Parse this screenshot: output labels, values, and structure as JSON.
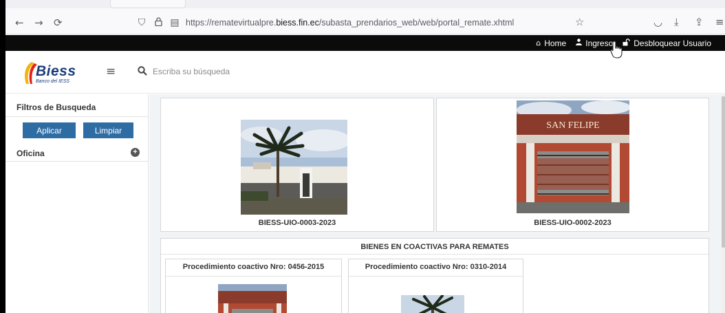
{
  "browser": {
    "url_prefix": "https://rematevirtualpre.",
    "url_domain": "biess.fin.ec",
    "url_path": "/subasta_prendarios_web/web/portal_remate.xhtml",
    "icons": {
      "back": "←",
      "forward": "→",
      "reload": "⟳",
      "shield": "⛉",
      "lock": "🔒",
      "reader": "▤",
      "star": "☆",
      "pocket": "◡",
      "download": "⤓",
      "share": "⇪",
      "menu": "≡"
    }
  },
  "topnav": {
    "home": "Home",
    "home_icon": "⌂",
    "login": "Ingreso",
    "login_icon": "👤",
    "unlock": "Desbloquear Usuario",
    "unlock_icon": "🔓"
  },
  "header": {
    "logo_text": "Biess",
    "logo_sub": "Banco del IESS",
    "menu_icon": "≡",
    "search_placeholder": "Escriba su búsqueda"
  },
  "sidebar": {
    "title": "Filtros de Busqueda",
    "apply_label": "Aplicar",
    "clear_label": "Limpiar",
    "office_label": "Oficina",
    "expand_icon": "+"
  },
  "main": {
    "cards": [
      {
        "code": "BIESS-UIO-0003-2023"
      },
      {
        "code": "BIESS-UIO-0002-2023",
        "sign_text": "SAN FELIPE"
      }
    ],
    "section_title": "BIENES EN COACTIVAS PARA REMATES",
    "procedures": [
      {
        "title": "Procedimiento coactivo Nro: 0456-2015"
      },
      {
        "title": "Procedimiento coactivo Nro: 0310-2014"
      }
    ]
  },
  "colors": {
    "topnav_bg": "#0b0b0b",
    "button_bg": "#2e6da4",
    "logo_blue": "#1c3d78",
    "content_bg": "#f1f4f6"
  }
}
